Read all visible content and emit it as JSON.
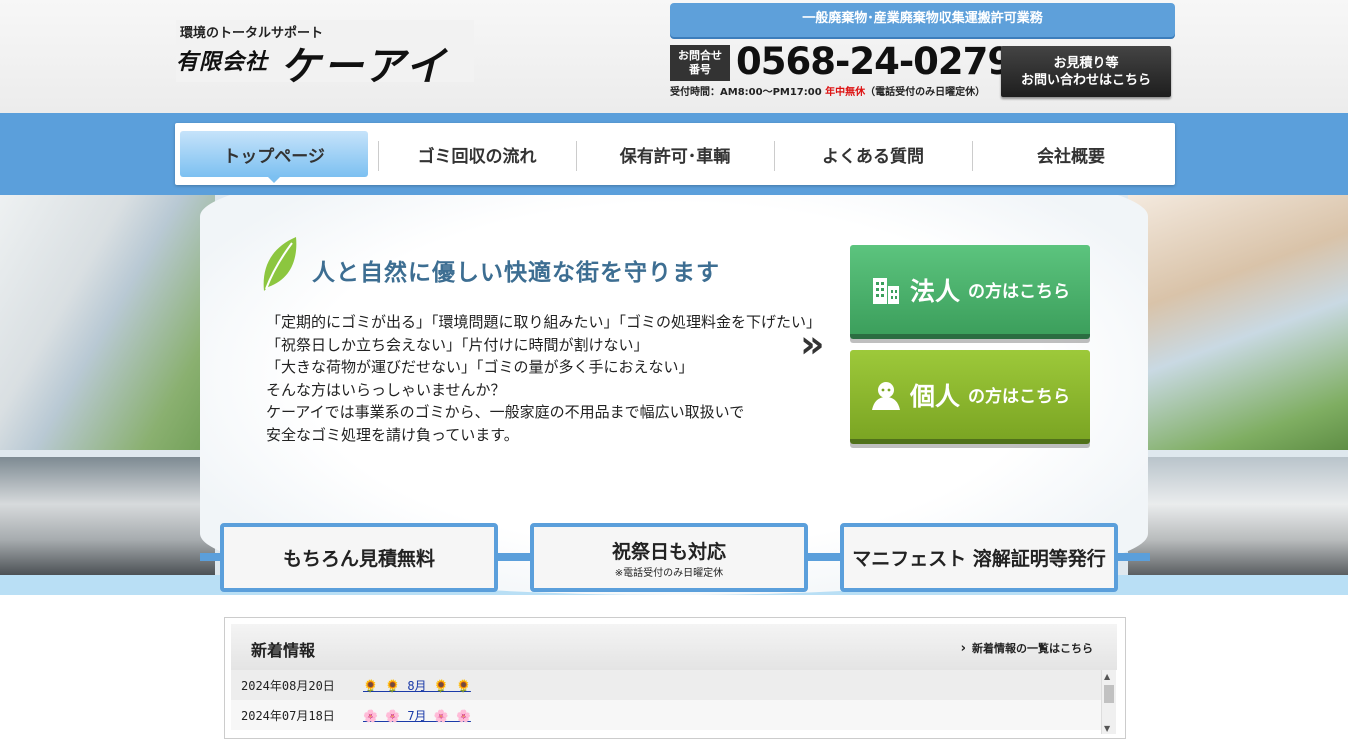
{
  "header": {
    "logo_tagline": "環境のトータルサポート",
    "logo_company": "有限会社",
    "logo_brand": "ケーアイ",
    "license": "一般廃棄物･産業廃棄物収集運搬許可業務",
    "tel_label_1": "お問合せ",
    "tel_label_2": "番号",
    "tel_number": "0568-24-0279",
    "hours_prefix": "受付時間：AM8:00〜PM17:00 ",
    "hours_red": "年中無休",
    "hours_suffix": "（電話受付のみ日曜定休）",
    "estimate_line1": "お見積り等",
    "estimate_line2": "お問い合わせはこちら"
  },
  "nav": {
    "items": [
      {
        "label": "トップページ"
      },
      {
        "label": "ゴミ回収の流れ"
      },
      {
        "label": "保有許可･車輌"
      },
      {
        "label": "よくある質問"
      },
      {
        "label": "会社概要"
      }
    ]
  },
  "hero": {
    "tagline": "人と自然に優しい快適な街を守ります",
    "lines": [
      "「定期的にゴミが出る」「環境問題に取り組みたい」「ゴミの処理料金を下げたい」",
      "「祝祭日しか立ち会えない」「片付けに時間が割けない」",
      "「大きな荷物が運びだせない」「ゴミの量が多く手におえない」",
      "そんな方はいらっしゃいませんか？",
      "ケーアイでは事業系のゴミから、一般家庭の不用品まで幅広い取扱いで",
      "安全なゴミ処理を請け負っています。"
    ],
    "chevron": "»",
    "cta_corp_main": "法人",
    "cta_corp_sub": "の方はこちら",
    "cta_ind_main": "個人",
    "cta_ind_sub": "の方はこちら"
  },
  "features": [
    {
      "big": "もちろん見積無料",
      "small": ""
    },
    {
      "big": "祝祭日も対応",
      "small": "※電話受付のみ日曜定休"
    },
    {
      "big": "マニフェスト 溶解証明等発行",
      "small": ""
    }
  ],
  "news": {
    "title": "新着情報",
    "more": "新着情報の一覧はこちら",
    "items": [
      {
        "date": "2024年08月20日",
        "link": "🌻 🌻 8月 🌻 🌻"
      },
      {
        "date": "2024年07月18日",
        "link": "🌸 🌸 7月 🌸 🌸"
      }
    ]
  },
  "colors": {
    "primary_blue": "#5b9fdb",
    "corp_green": "#3c9f5c",
    "individual_green": "#7ba523",
    "headline_blue": "#3d6e92"
  }
}
